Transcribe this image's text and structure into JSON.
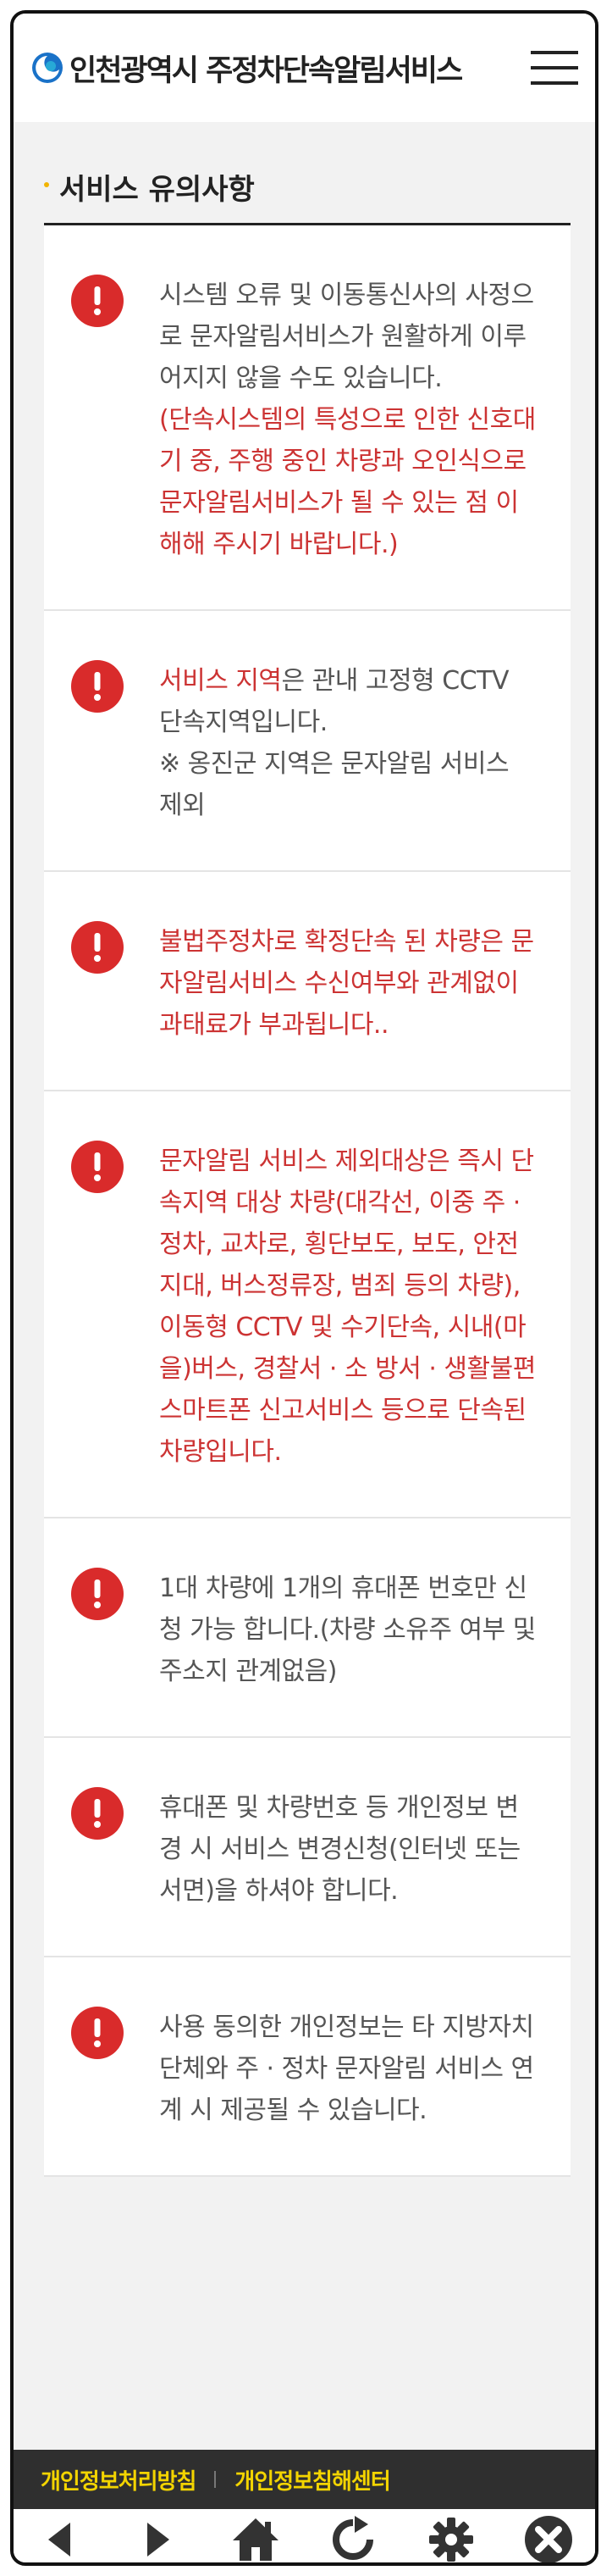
{
  "header": {
    "title": "인천광역시 주정차단속알림서비스",
    "logo_color": "#1a72c8"
  },
  "section": {
    "title": "서비스 유의사항"
  },
  "notices": [
    {
      "parts": [
        {
          "text": "시스템 오류 및 이동통신사의 사정으로 문자알림서비스가 원활하게 이루어지지 않을 수도 있습니다.",
          "highlight": false
        },
        {
          "text": "(단속시스템의 특성으로 인한 신호대기 중, 주행 중인 차량과 오인식으로 문자알림서비스가 될 수 있는 점 이해해 주시기 바랍니다.)",
          "highlight": true
        }
      ]
    },
    {
      "parts": [
        {
          "text": "서비스 지역",
          "highlight": true
        },
        {
          "text": "은 관내 고정형 CCTV 단속지역입니다.",
          "highlight": false
        },
        {
          "text": "※ 옹진군 지역은 문자알림 서비스 제외",
          "highlight": false
        }
      ]
    },
    {
      "parts": [
        {
          "text": "불법주정차로 확정단속 된 차량은 문자알림서비스 수신여부와 관계없이 과태료가 부과됩니다..",
          "highlight": true
        }
      ]
    },
    {
      "parts": [
        {
          "text": "문자알림 서비스 제외대상은 즉시 단속지역 대상 차량(대각선, 이중 주 · 정차, 교차로, 횡단보도, 보도, 안전지대, 버스정류장, 범죄 등의 차량), 이동형 CCTV 및 수기단속, 시내(마을)버스, 경찰서 · 소 방서 · 생활불편 스마트폰 신고서비스 등으로 단속된 차량입니다.",
          "highlight": true
        }
      ]
    },
    {
      "parts": [
        {
          "text": "1대 차량에 1개의 휴대폰 번호만 신청 가능 합니다.(차량 소유주 여부 및 주소지 관계없음)",
          "highlight": false
        }
      ]
    },
    {
      "parts": [
        {
          "text": "휴대폰 및 차량번호 등 개인정보 변경 시 서비스 변경신청(인터넷 또는 서면)을 하셔야 합니다.",
          "highlight": false
        }
      ]
    },
    {
      "parts": [
        {
          "text": "사용 동의한 개인정보는 타 지방자치단체와 주 · 정차 문자알림 서비스 연계 시 제공될 수 있습니다.",
          "highlight": false
        }
      ]
    }
  ],
  "footer": {
    "links": [
      "개인정보처리방침",
      "개인정보침해센터"
    ]
  },
  "nav": {
    "icons": [
      "back-icon",
      "forward-icon",
      "home-icon",
      "refresh-icon",
      "settings-icon",
      "close-icon"
    ]
  },
  "colors": {
    "notice_red": "#c33333",
    "icon_red": "#d92b2b",
    "footer_link": "#f3d400"
  }
}
